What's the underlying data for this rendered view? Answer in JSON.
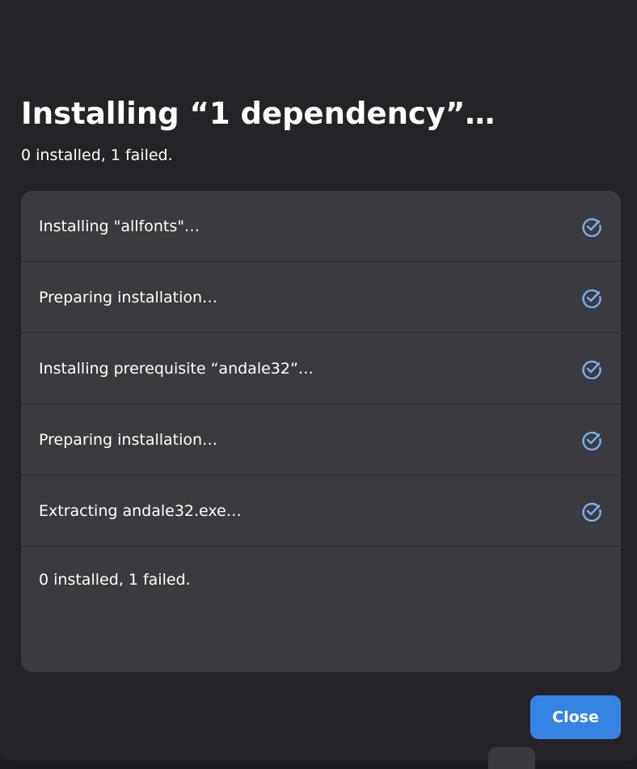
{
  "dialog": {
    "title": "Installing “1 dependency”…",
    "subtitle": "0 installed, 1 failed.",
    "steps": [
      {
        "label": "Installing \"allfonts\"…",
        "icon": "check-circle-icon"
      },
      {
        "label": "Preparing installation…",
        "icon": "check-circle-icon"
      },
      {
        "label": "Installing prerequisite “andale32”…",
        "icon": "check-circle-icon"
      },
      {
        "label": "Preparing installation…",
        "icon": "check-circle-icon"
      },
      {
        "label": "Extracting andale32.exe…",
        "icon": "check-circle-icon"
      }
    ],
    "summary": "0 installed, 1 failed.",
    "close_label": "Close"
  },
  "colors": {
    "accent": "#3584e4",
    "check": "#78aeed",
    "dialog_bg": "#242428",
    "list_bg": "#3b3b3f"
  }
}
